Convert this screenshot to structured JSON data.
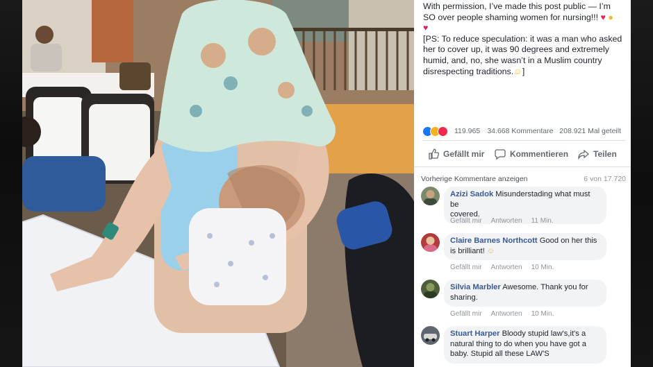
{
  "post": {
    "line1": "With permission, I’ve made this post public — I’m",
    "line2": "SO over people shaming women for nursing!!!",
    "line3": "[PS: To reduce speculation: it was a man who asked",
    "line4": "her to cover up, it was 90 degrees and extremely",
    "line5": "humid, and, no, she wasn’t in a Muslim country",
    "line6": "disrespecting traditions.",
    "line6_end": "]"
  },
  "reactions": {
    "count": "119.965",
    "comments": "34.668 Kommentare",
    "shares": "208.921 Mal geteilt"
  },
  "actions": {
    "like": "Gefällt mir",
    "comment": "Kommentieren",
    "share": "Teilen"
  },
  "comments_header": {
    "previous": "Vorherige Kommentare anzeigen",
    "count": "6 von 17.720"
  },
  "comments": [
    {
      "name": "Azizi Sadok",
      "text1": "Misunderstading what must be",
      "text2": "covered.",
      "like": "Gefällt mir",
      "reply": "Antworten",
      "time": "11 Min."
    },
    {
      "name": "Claire Barnes Northcott",
      "text1": "Good on her this",
      "text2": "is brilliant!",
      "like": "Gefällt mir",
      "reply": "Antworten",
      "time": "10 Min."
    },
    {
      "name": "Silvia Marbler",
      "text1": "Awesome. Thank you for",
      "text2": "sharing.",
      "like": "Gefällt mir",
      "reply": "Antworten",
      "time": "10 Min."
    },
    {
      "name": "Stuart Harper",
      "text1": "Bloody stupid law's,it's a",
      "text2": "natural thing to do when you have got a",
      "text3": "baby. Stupid all these LAW'S"
    }
  ],
  "colors": {
    "link": "#385898",
    "like_blue": "#1877f2",
    "love_red": "#f0284a",
    "haha_yellow": "#f7b125"
  }
}
